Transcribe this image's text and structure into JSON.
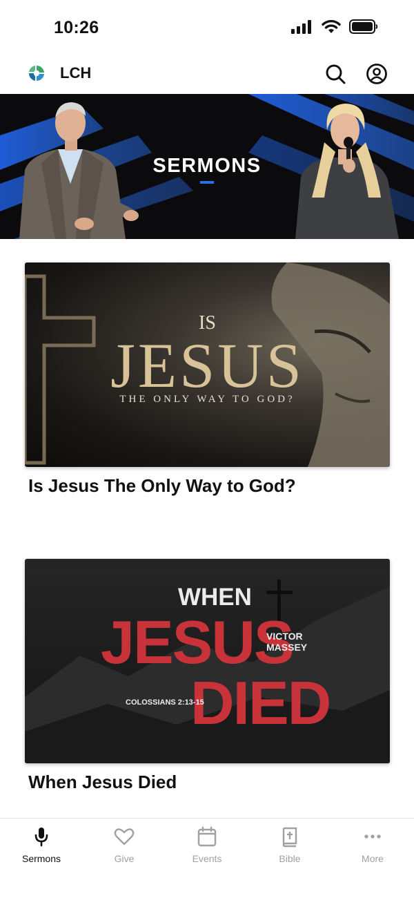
{
  "status_bar": {
    "time": "10:26"
  },
  "header": {
    "app_title": "LCH"
  },
  "banner": {
    "title": "SERMONS"
  },
  "sermons": [
    {
      "title": "Is Jesus The Only Way to God?",
      "artwork": {
        "line1": "IS",
        "line2": "JESUS",
        "line3": "THE ONLY WAY TO GOD?"
      }
    },
    {
      "title": "When Jesus Died",
      "artwork": {
        "line1": "WHEN",
        "line2": "JESUS",
        "line3": "DIED",
        "speaker": "VICTOR MASSEY",
        "scripture": "COLOSSIANS 2:13-15"
      }
    }
  ],
  "tabs": [
    {
      "label": "Sermons",
      "icon": "microphone-icon",
      "active": true
    },
    {
      "label": "Give",
      "icon": "heart-icon",
      "active": false
    },
    {
      "label": "Events",
      "icon": "calendar-icon",
      "active": false
    },
    {
      "label": "Bible",
      "icon": "bible-icon",
      "active": false
    },
    {
      "label": "More",
      "icon": "more-icon",
      "active": false
    }
  ],
  "colors": {
    "accent": "#2a6ee8",
    "active_tab": "#111111",
    "inactive_tab": "#a0a0a0",
    "red_title": "#c8333a"
  }
}
